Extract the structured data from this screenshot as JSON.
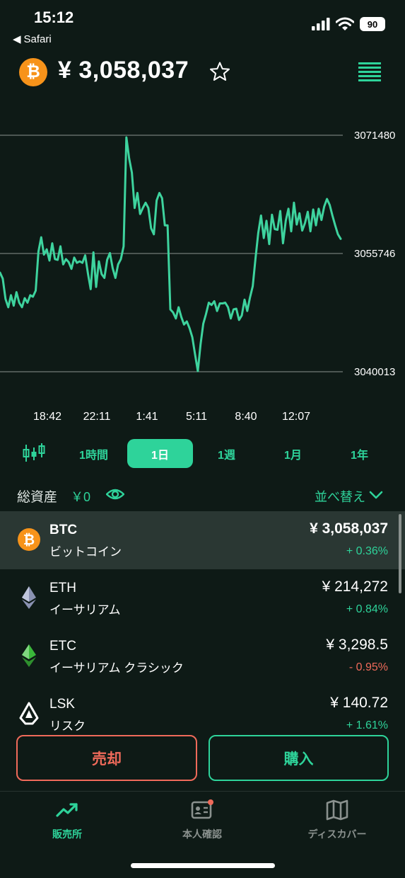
{
  "status_bar": {
    "time": "15:12",
    "back_app": "Safari",
    "battery": "90"
  },
  "header": {
    "coin_logo_symbol": "₿",
    "price": "¥ 3,058,037",
    "star_icon": "star-outline-icon",
    "menu_icon": "order-book-icon"
  },
  "chart_data": {
    "type": "line",
    "x_tick_labels": [
      "18:42",
      "22:11",
      "1:41",
      "5:11",
      "8:40",
      "12:07"
    ],
    "y_reference_lines": [
      3071480,
      3055746,
      3040013
    ],
    "ylim": [
      3040013,
      3071480
    ],
    "values": [
      3053200,
      3052400,
      3049700,
      3048600,
      3050200,
      3048800,
      3050600,
      3049200,
      3048600,
      3049800,
      3049200,
      3050200,
      3050000,
      3050800,
      3056000,
      3057900,
      3055600,
      3056300,
      3054800,
      3057100,
      3055000,
      3054900,
      3056700,
      3054300,
      3055000,
      3054600,
      3053700,
      3055200,
      3054500,
      3054700,
      3054500,
      3055500,
      3053100,
      3051000,
      3055900,
      3051300,
      3054700,
      3053000,
      3052500,
      3054900,
      3055800,
      3053800,
      3052500,
      3054300,
      3055000,
      3056700,
      3071200,
      3068400,
      3066500,
      3061800,
      3063800,
      3061000,
      3061800,
      3062500,
      3061800,
      3059100,
      3058300,
      3062800,
      3063800,
      3063100,
      3059500,
      3059500,
      3048300,
      3047900,
      3047100,
      3048600,
      3047300,
      3046300,
      3046700,
      3045800,
      3044600,
      3042300,
      3040100,
      3043700,
      3046400,
      3047700,
      3049200,
      3048900,
      3049400,
      3048100,
      3049100,
      3049100,
      3049200,
      3048600,
      3047100,
      3048300,
      3048400,
      3046900,
      3047500,
      3049600,
      3048100,
      3049900,
      3051400,
      3055100,
      3058500,
      3060800,
      3057800,
      3060100,
      3057000,
      3060900,
      3059000,
      3058900,
      3061400,
      3057100,
      3060100,
      3061700,
      3058700,
      3062500,
      3059600,
      3061100,
      3058800,
      3059800,
      3061300,
      3058700,
      3061600,
      3059500,
      3061700,
      3060200,
      3062000,
      3063000,
      3062200,
      3060800,
      3059500,
      3058300,
      3057700
    ],
    "grid": true,
    "legend": "none",
    "line_color": "#3ed39e"
  },
  "period_tabs": [
    "1時間",
    "1日",
    "1週",
    "1月",
    "1年"
  ],
  "active_tab_index": 1,
  "assets": {
    "label": "総資産",
    "value": "￥0",
    "sort_label": "並べ替え"
  },
  "coins": [
    {
      "symbol": "BTC",
      "name": "ビットコイン",
      "price": "¥ 3,058,037",
      "change": "+ 0.36%",
      "direction": "up",
      "icon": "bitcoin-icon",
      "color": "#f7931a"
    },
    {
      "symbol": "ETH",
      "name": "イーサリアム",
      "price": "¥ 214,272",
      "change": "+ 0.84%",
      "direction": "up",
      "icon": "ethereum-icon",
      "color": "#8a92b2"
    },
    {
      "symbol": "ETC",
      "name": "イーサリアム クラシック",
      "price": "¥ 3,298.5",
      "change": "- 0.95%",
      "direction": "down",
      "icon": "ethereum-classic-icon",
      "color": "#3ab83a"
    },
    {
      "symbol": "LSK",
      "name": "リスク",
      "price": "¥ 140.72",
      "change": "+ 1.61%",
      "direction": "up",
      "icon": "lisk-icon",
      "color": "#ffffff"
    }
  ],
  "actions": {
    "sell": "売却",
    "buy": "購入"
  },
  "bottom_nav": [
    {
      "label": "販売所",
      "icon": "trend-up-icon"
    },
    {
      "label": "本人確認",
      "icon": "id-card-icon"
    },
    {
      "label": "ディスカバー",
      "icon": "map-icon"
    }
  ],
  "colors": {
    "accent": "#2ed39a",
    "negative": "#ef6a5a",
    "background": "#0e1a16"
  }
}
